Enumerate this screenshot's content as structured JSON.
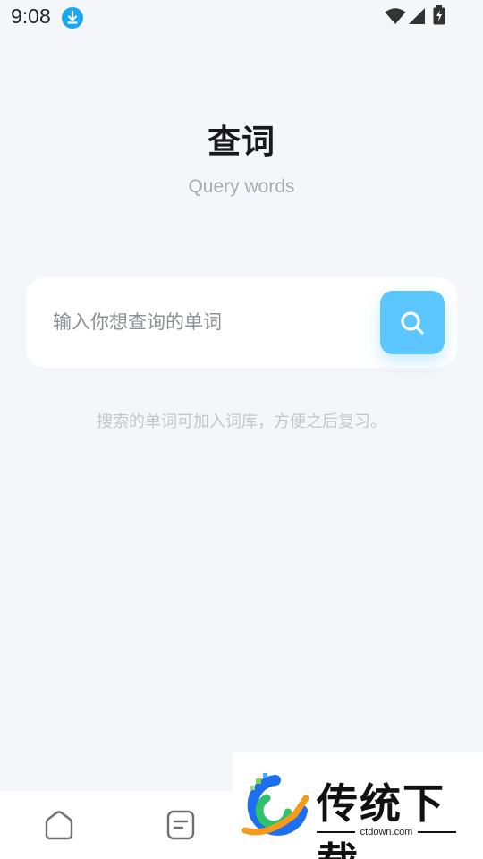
{
  "status_bar": {
    "time": "9:08",
    "icons": [
      "download-icon",
      "wifi-icon",
      "signal-icon",
      "battery-icon"
    ]
  },
  "header": {
    "title": "查词",
    "subtitle": "Query words"
  },
  "search": {
    "placeholder": "输入你想查询的单词",
    "value": "",
    "button_icon": "search-icon",
    "button_color": "#5cc7ff"
  },
  "hint": "搜索的单词可加入词库，方便之后复习。",
  "bottom_nav": {
    "items": [
      {
        "icon": "home-icon"
      },
      {
        "icon": "notes-icon"
      }
    ]
  },
  "watermark": {
    "brand": "传统下载",
    "url": "ctdown.com"
  },
  "colors": {
    "background": "#f5f6fa",
    "accent": "#5cc7ff",
    "status_download": "#1aa7f2"
  }
}
